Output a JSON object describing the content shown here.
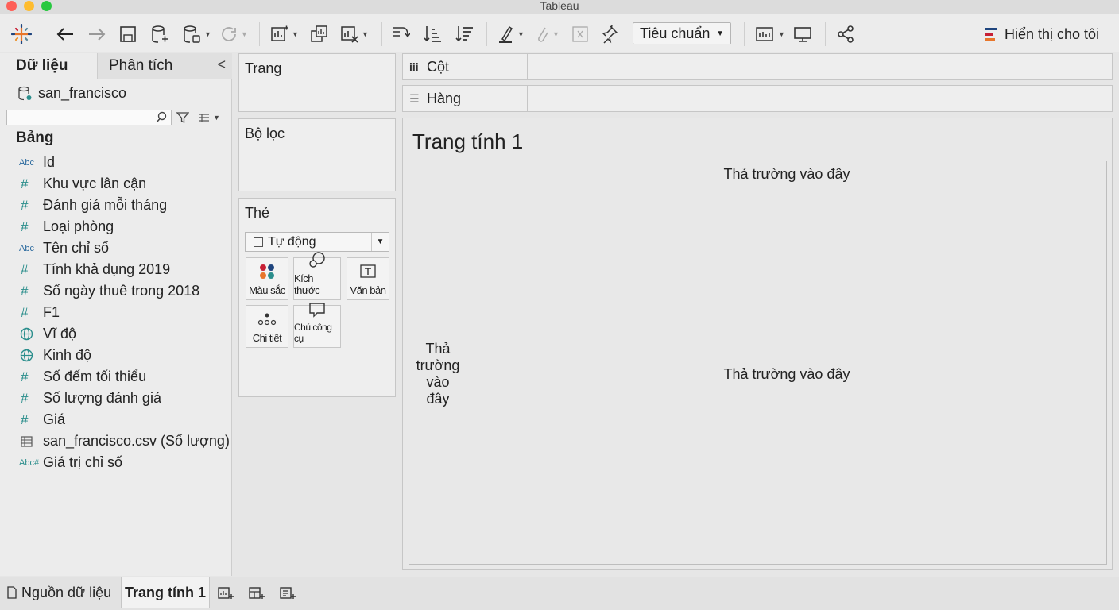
{
  "window": {
    "title": "Tableau"
  },
  "toolbar": {
    "icons": [
      "tableau-logo-icon",
      "back-icon",
      "forward-icon",
      "save-icon",
      "new-datasource-icon",
      "pause-updates-icon",
      "refresh-icon",
      "new-worksheet-icon",
      "duplicate-sheet-icon",
      "clear-sheet-icon",
      "swap-rows-columns-icon",
      "sort-ascending-icon",
      "sort-descending-icon",
      "highlight-icon",
      "group-members-icon",
      "labels-icon",
      "fix-axes-icon",
      "presentation-mode-icon",
      "share-icon"
    ],
    "fit_select": "Tiêu chuẩn",
    "show_me_label": "Hiển thị cho tôi"
  },
  "data_pane": {
    "tab_data": "Dữ liệu",
    "tab_analysis": "Phân tích",
    "collapse_glyph": "<",
    "datasource": "san_francisco",
    "search_placeholder": "",
    "section_title": "Bảng",
    "fields": [
      {
        "icon": "Abc",
        "label": "Id"
      },
      {
        "icon": "#",
        "label": "Khu vực lân cận"
      },
      {
        "icon": "#",
        "label": "Đánh giá mỗi tháng"
      },
      {
        "icon": "#",
        "label": "Loại phòng"
      },
      {
        "icon": "Abc",
        "label": "Tên chỉ số"
      },
      {
        "icon": "#",
        "label": "Tính khả dụng 2019"
      },
      {
        "icon": "#",
        "label": "Số ngày thuê trong 2018"
      },
      {
        "icon": "#",
        "label": "F1"
      },
      {
        "icon": "globe",
        "label": "Vĩ độ"
      },
      {
        "icon": "globe",
        "label": "Kinh độ"
      },
      {
        "icon": "#",
        "label": "Số đếm tối thiểu"
      },
      {
        "icon": "#",
        "label": "Số lượng đánh giá"
      },
      {
        "icon": "#",
        "label": "Giá"
      },
      {
        "icon": "table",
        "label": "san_francisco.csv (Số lượng)"
      },
      {
        "icon": "Abc#",
        "label": "Giá trị chỉ số"
      }
    ]
  },
  "cards": {
    "pages_title": "Trang",
    "filters_title": "Bộ lọc",
    "marks_title": "Thẻ",
    "marks_type": "Tự động",
    "buttons": {
      "color": "Màu sắc",
      "size": "Kích thước",
      "text": "Văn bản",
      "detail": "Chi tiết",
      "tooltip": "Chú công cụ"
    }
  },
  "shelves": {
    "columns_label": "Cột",
    "rows_label": "Hàng"
  },
  "sheet": {
    "title": "Trang tính 1",
    "drop_top": "Thả trường vào đây",
    "drop_left_lines": [
      "Thả",
      "trường",
      "vào",
      "đây"
    ],
    "drop_center": "Thả trường vào đây"
  },
  "bottom": {
    "datasource_tab": "Nguồn dữ liệu",
    "sheet_tab": "Trang tính 1"
  },
  "colors": {
    "accent_teal": "#2b8e8c",
    "accent_blue": "#2b6a9e",
    "traffic_red": "#fe5f57",
    "traffic_yellow": "#febc2e",
    "traffic_green": "#28c840"
  }
}
